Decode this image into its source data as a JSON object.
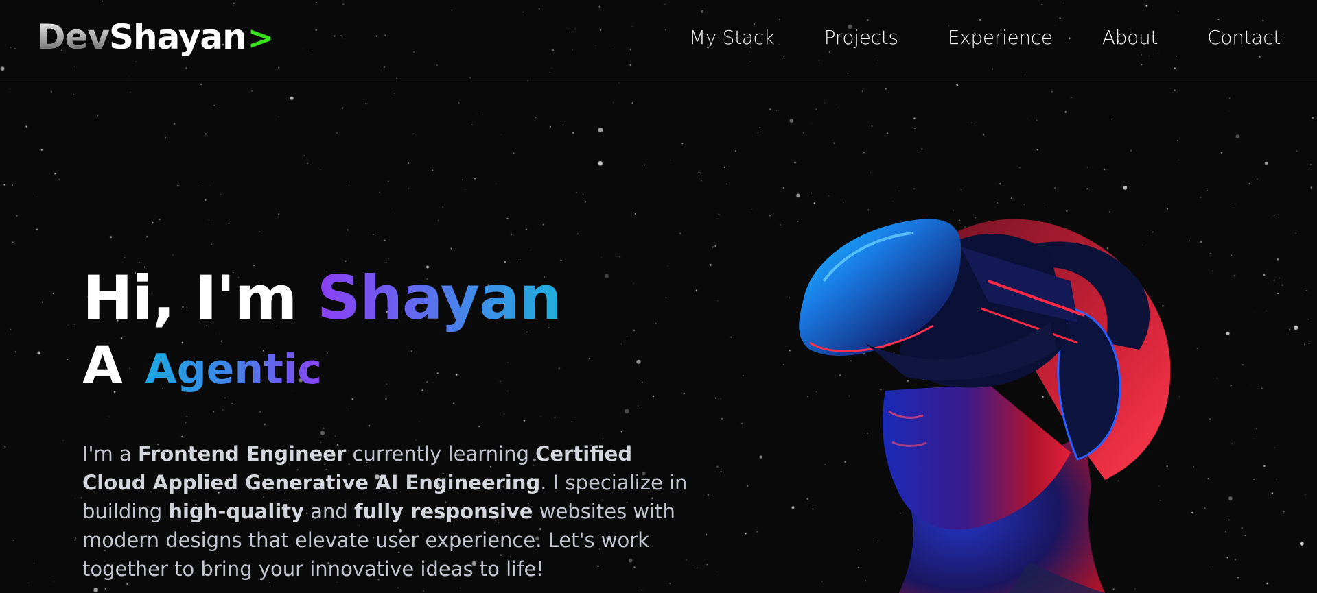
{
  "header": {
    "logo": {
      "dev": "Dev",
      "name": "Shayan",
      "chevron": ">"
    },
    "nav": [
      "My Stack",
      "Projects",
      "Experience",
      "About",
      "Contact"
    ]
  },
  "hero": {
    "greeting": "Hi, I'm ",
    "name": "Shayan",
    "prefix": "A",
    "role": "Agentic",
    "description": {
      "p1": "I'm a ",
      "b1": "Frontend Engineer",
      "p2": " currently learning ",
      "b2": "Certified Cloud Applied Generative AI Engineering",
      "p3": ". I specialize in building ",
      "b3": "high-quality",
      "p4": " and ",
      "b4": "fully responsive",
      "p5": " websites with modern designs that elevate user experience. Let's work together to bring your innovative ideas to life!"
    }
  },
  "colors": {
    "background": "#0a0a0b",
    "accent_green": "#39e01c",
    "gradient_purple": "#8b3ff3",
    "gradient_blue": "#1fb0dc",
    "neon_red": "#ff2a44"
  },
  "icons": {
    "hero_image": "vr-headset-person-illustration",
    "background": "starfield"
  }
}
